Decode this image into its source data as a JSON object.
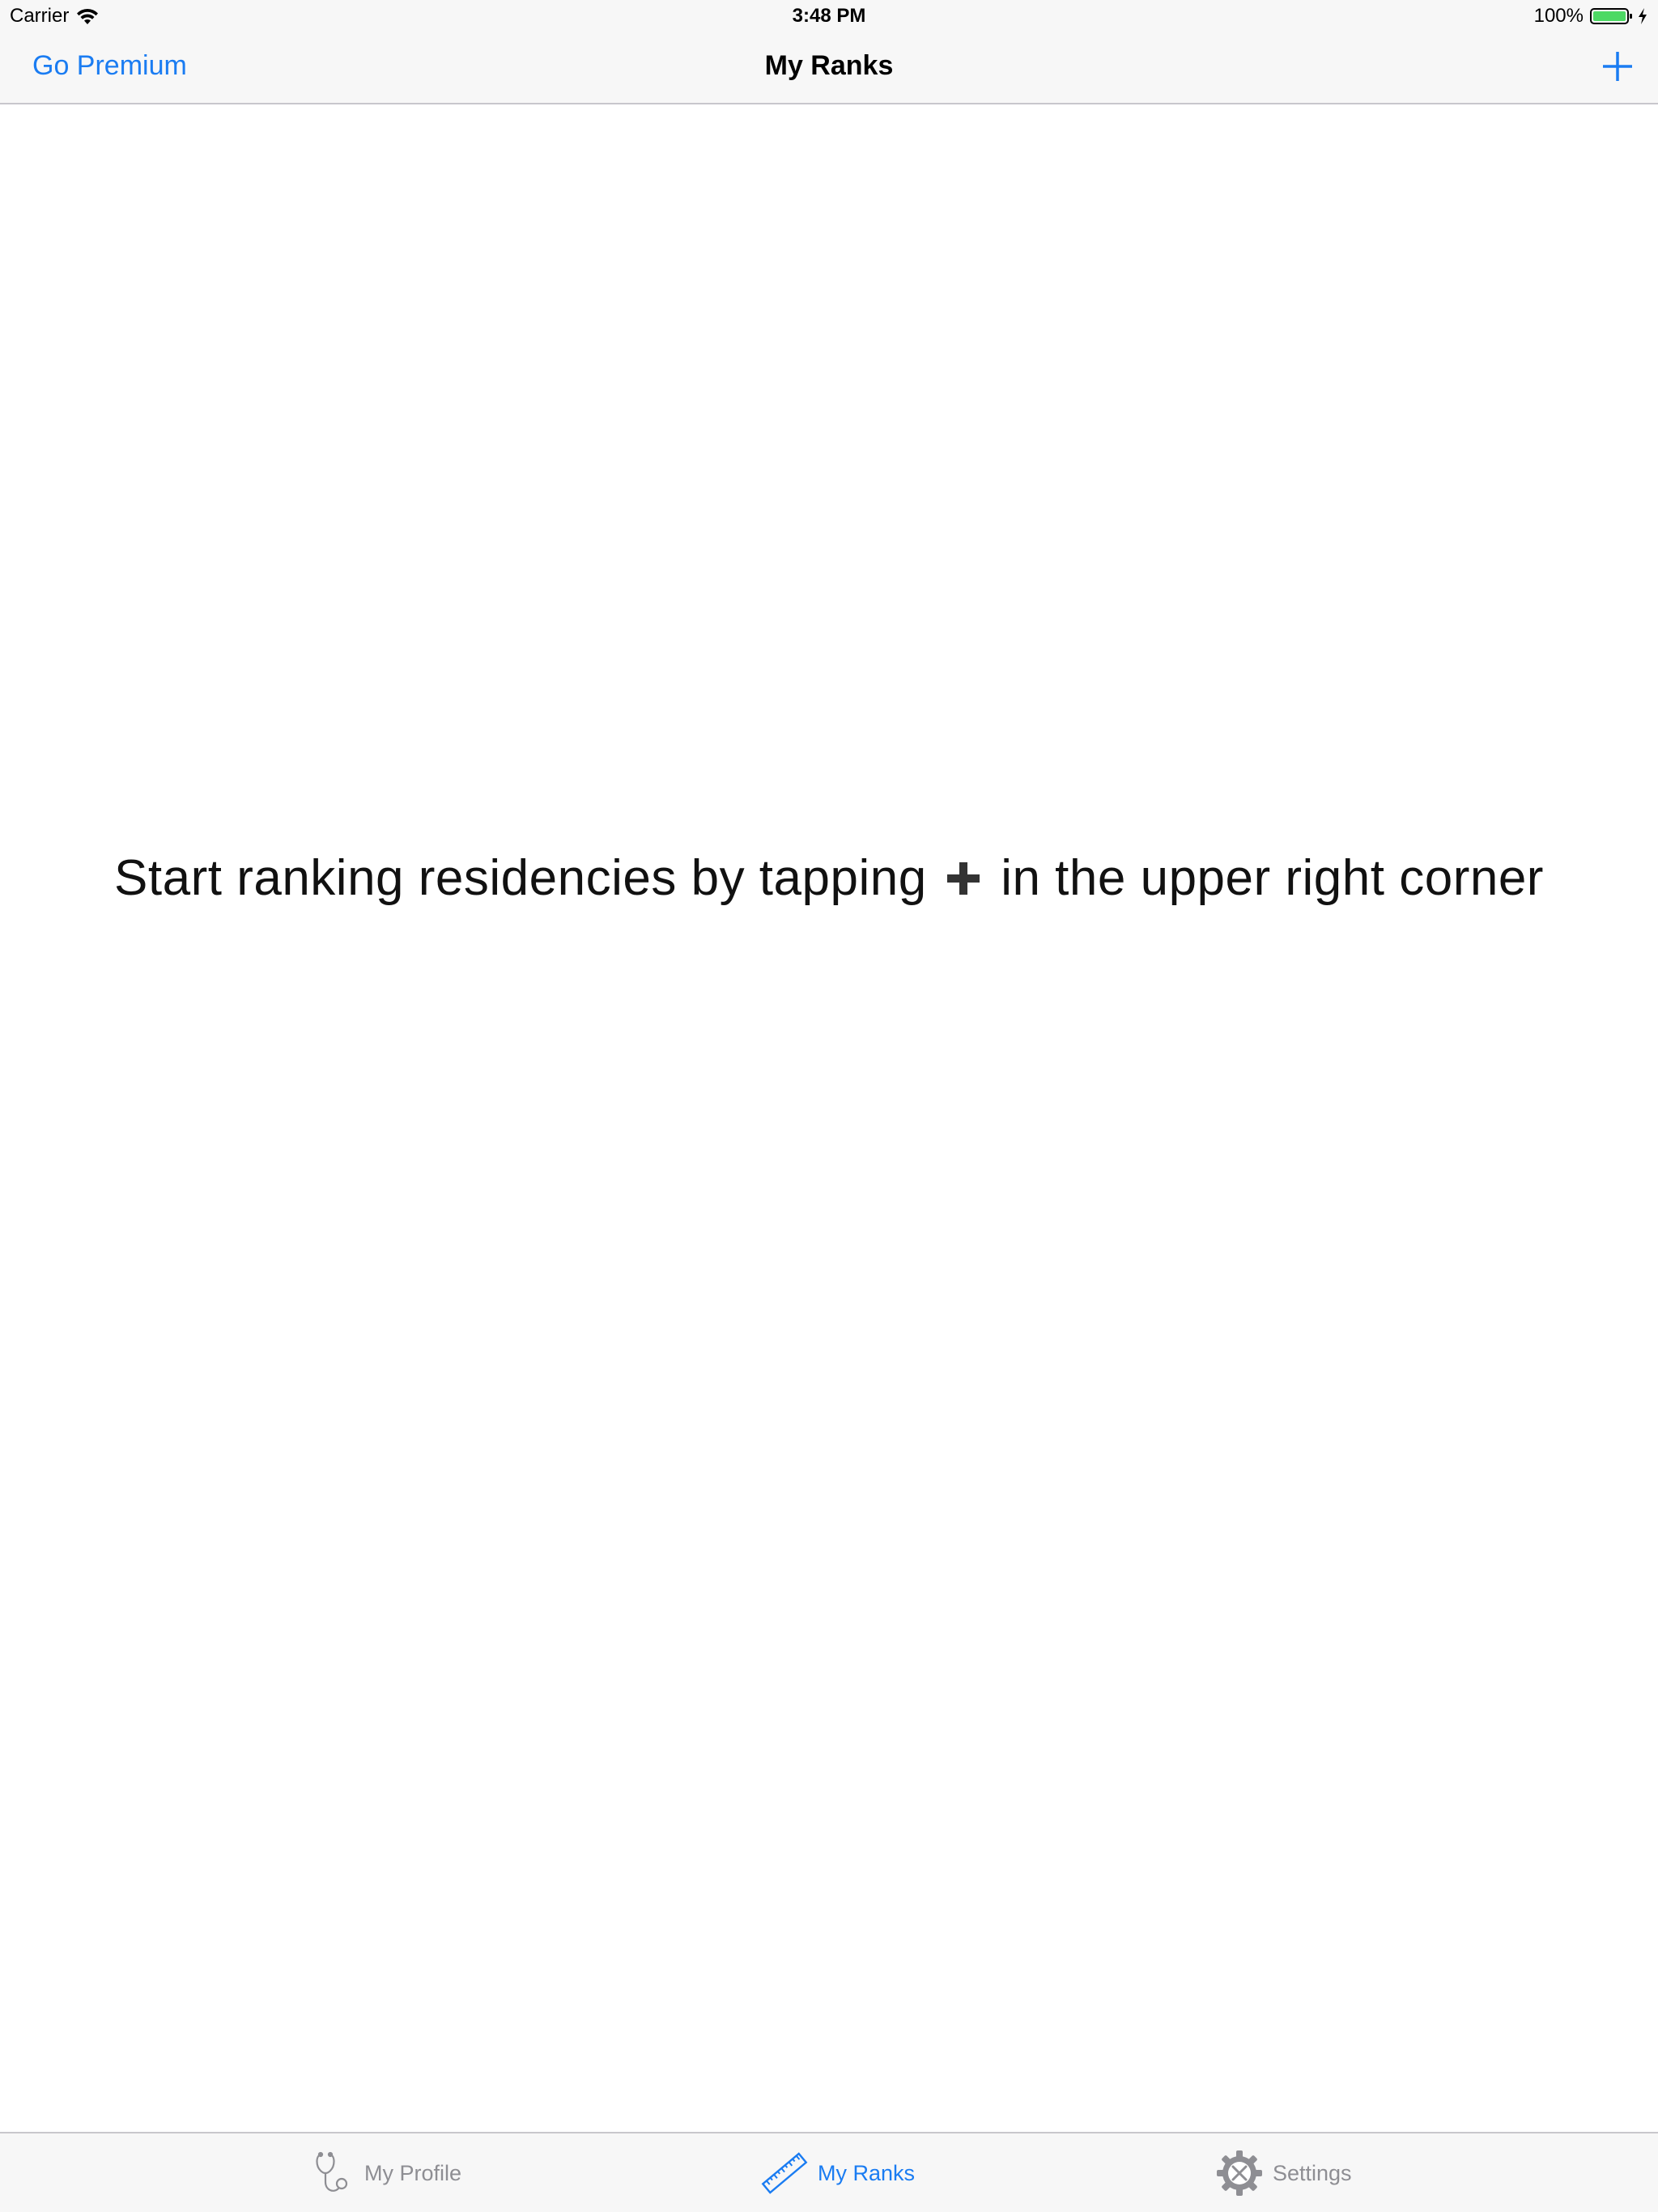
{
  "status_bar": {
    "carrier": "Carrier",
    "time": "3:48 PM",
    "battery": "100%"
  },
  "nav": {
    "left_button": "Go Premium",
    "title": "My Ranks",
    "add_icon": "plus-icon"
  },
  "main": {
    "message_before": "Start ranking residencies by tapping",
    "message_after": "in the upper right corner",
    "inline_icon": "heavy-plus-icon"
  },
  "tabs": [
    {
      "label": "My Profile",
      "icon": "stethoscope-icon",
      "active": false
    },
    {
      "label": "My Ranks",
      "icon": "ruler-icon",
      "active": true
    },
    {
      "label": "Settings",
      "icon": "gear-tools-icon",
      "active": false
    }
  ],
  "colors": {
    "accent": "#1a7cf2",
    "inactive": "#8e8e93",
    "bar_background": "#f7f7f7",
    "battery_fill": "#4cd964"
  }
}
